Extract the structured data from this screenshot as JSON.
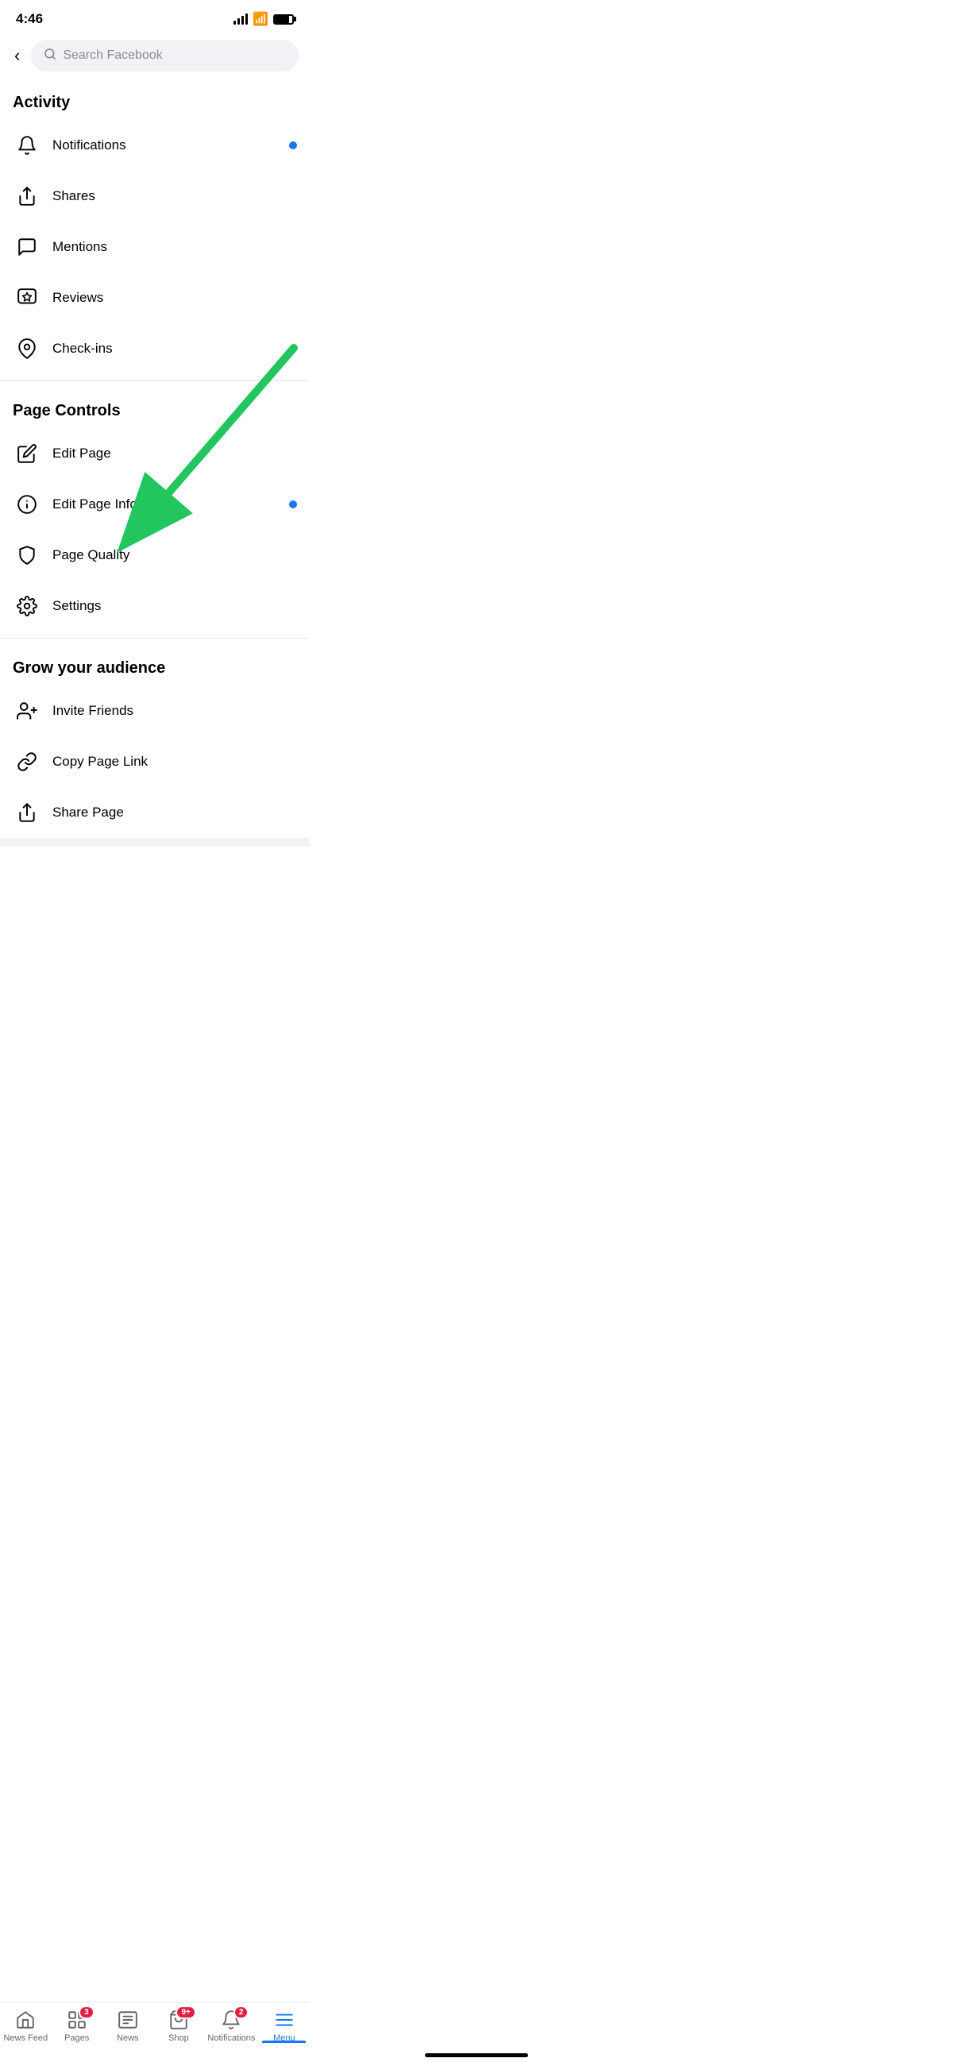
{
  "statusBar": {
    "time": "4:46"
  },
  "searchBar": {
    "placeholder": "Search Facebook",
    "backLabel": "‹"
  },
  "sections": [
    {
      "id": "activity",
      "header": "Activity",
      "items": [
        {
          "id": "notifications",
          "label": "Notifications",
          "icon": "bell",
          "hasDot": true
        },
        {
          "id": "shares",
          "label": "Shares",
          "icon": "share",
          "hasDot": false
        },
        {
          "id": "mentions",
          "label": "Mentions",
          "icon": "mention",
          "hasDot": false
        },
        {
          "id": "reviews",
          "label": "Reviews",
          "icon": "star-bubble",
          "hasDot": false
        },
        {
          "id": "checkins",
          "label": "Check-ins",
          "icon": "location",
          "hasDot": false
        }
      ]
    },
    {
      "id": "page-controls",
      "header": "Page Controls",
      "items": [
        {
          "id": "edit-page",
          "label": "Edit Page",
          "icon": "pencil",
          "hasDot": false
        },
        {
          "id": "edit-page-info",
          "label": "Edit Page Info",
          "icon": "info-circle",
          "hasDot": true
        },
        {
          "id": "page-quality",
          "label": "Page Quality",
          "icon": "shield",
          "hasDot": false
        },
        {
          "id": "settings",
          "label": "Settings",
          "icon": "gear",
          "hasDot": false
        }
      ]
    },
    {
      "id": "grow-audience",
      "header": "Grow your audience",
      "items": [
        {
          "id": "invite-friends",
          "label": "Invite Friends",
          "icon": "person-plus",
          "hasDot": false
        },
        {
          "id": "copy-page-link",
          "label": "Copy Page Link",
          "icon": "link",
          "hasDot": false
        },
        {
          "id": "share-page",
          "label": "Share Page",
          "icon": "share-page",
          "hasDot": false
        }
      ]
    }
  ],
  "tabBar": {
    "items": [
      {
        "id": "news-feed",
        "label": "News Feed",
        "icon": "home",
        "badge": null,
        "active": false
      },
      {
        "id": "pages",
        "label": "Pages",
        "icon": "pages",
        "badge": "3",
        "active": false
      },
      {
        "id": "news",
        "label": "News",
        "icon": "news",
        "badge": null,
        "active": false
      },
      {
        "id": "shop",
        "label": "Shop",
        "icon": "shop",
        "badge": "9+",
        "active": false
      },
      {
        "id": "notifications-tab",
        "label": "Notifications",
        "icon": "bell-tab",
        "badge": "2",
        "active": false
      },
      {
        "id": "menu",
        "label": "Menu",
        "icon": "menu",
        "badge": null,
        "active": true
      }
    ]
  }
}
